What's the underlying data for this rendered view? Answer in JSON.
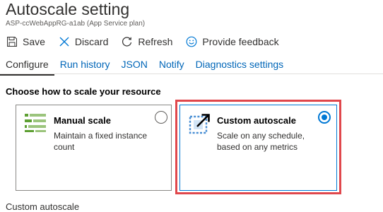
{
  "header": {
    "title": "Autoscale setting",
    "subtitle": "ASP-ccWebAppRG-a1ab (App Service plan)"
  },
  "toolbar": {
    "save_label": "Save",
    "discard_label": "Discard",
    "refresh_label": "Refresh",
    "feedback_label": "Provide feedback"
  },
  "tabs": [
    {
      "label": "Configure"
    },
    {
      "label": "Run history"
    },
    {
      "label": "JSON"
    },
    {
      "label": "Notify"
    },
    {
      "label": "Diagnostics settings"
    }
  ],
  "main": {
    "section_heading": "Choose how to scale your resource",
    "manual": {
      "title": "Manual scale",
      "description": "Maintain a fixed instance count",
      "selected": false
    },
    "custom": {
      "title": "Custom autoscale",
      "description": "Scale on any schedule, based on any metrics",
      "selected": true
    },
    "next_heading": "Custom autoscale"
  },
  "colors": {
    "accent": "#0078d4",
    "highlight_border": "#e0474c",
    "manual_icon": "#5ea033"
  }
}
